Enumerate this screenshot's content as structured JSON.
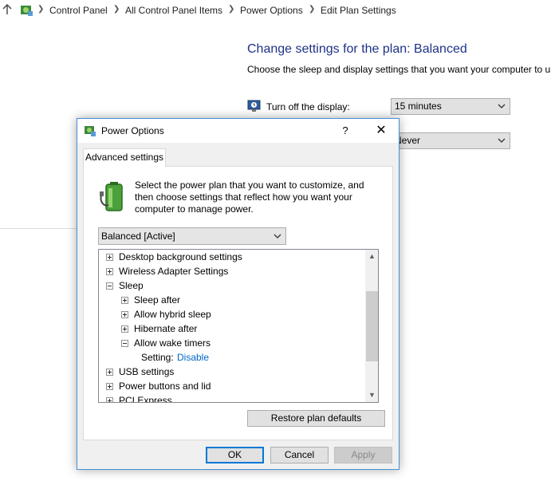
{
  "breadcrumb": {
    "items": [
      "Control Panel",
      "All Control Panel Items",
      "Power Options",
      "Edit Plan Settings"
    ]
  },
  "plan_page": {
    "title": "Change settings for the plan: Balanced",
    "subtitle": "Choose the sleep and display settings that you want your computer to use.",
    "display_label": "Turn off the display:",
    "display_value": "15 minutes",
    "sleep_value": "Never"
  },
  "dialog": {
    "title": "Power Options",
    "help_glyph": "?",
    "close_glyph": "✕",
    "tab_label": "Advanced settings",
    "intro": "Select the power plan that you want to customize, and then choose settings that reflect how you want your computer to manage power.",
    "plan_selected": "Balanced [Active]",
    "tree": [
      {
        "label": "Desktop background settings",
        "level": 0,
        "state": "collapsed"
      },
      {
        "label": "Wireless Adapter Settings",
        "level": 0,
        "state": "collapsed"
      },
      {
        "label": "Sleep",
        "level": 0,
        "state": "expanded"
      },
      {
        "label": "Sleep after",
        "level": 1,
        "state": "collapsed"
      },
      {
        "label": "Allow hybrid sleep",
        "level": 1,
        "state": "collapsed"
      },
      {
        "label": "Hibernate after",
        "level": 1,
        "state": "collapsed"
      },
      {
        "label": "Allow wake timers",
        "level": 1,
        "state": "expanded"
      },
      {
        "label": "Setting:",
        "value": "Disable",
        "level": 2,
        "state": "leaf"
      },
      {
        "label": "USB settings",
        "level": 0,
        "state": "collapsed"
      },
      {
        "label": "Power buttons and lid",
        "level": 0,
        "state": "collapsed"
      },
      {
        "label": "PCI Express",
        "level": 0,
        "state": "collapsed"
      }
    ],
    "restore_label": "Restore plan defaults",
    "ok_label": "OK",
    "cancel_label": "Cancel",
    "apply_label": "Apply"
  },
  "colors": {
    "link": "#0066cc",
    "heading": "#1e3287",
    "dialog_border": "#4c8fd6",
    "default_button_border": "#0078d7"
  }
}
